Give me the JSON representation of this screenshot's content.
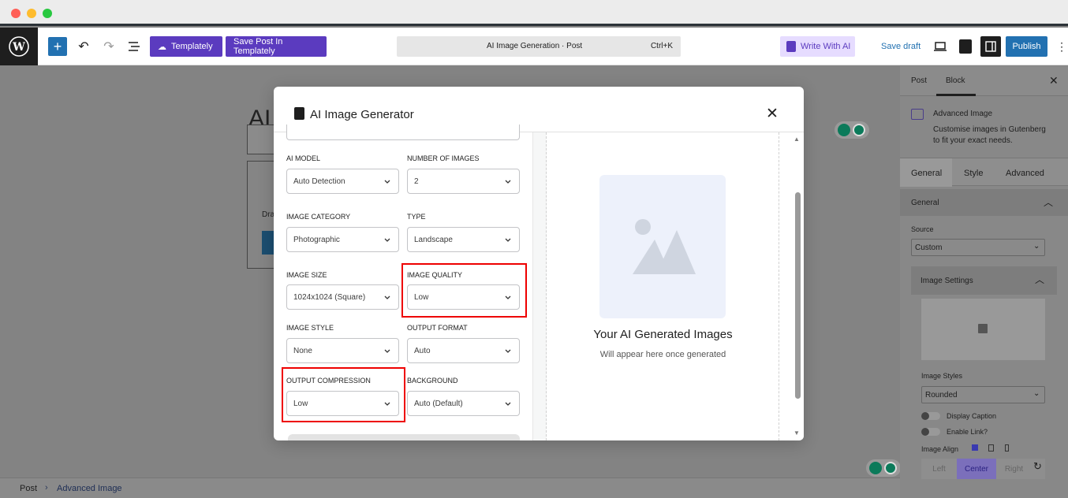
{
  "toolbar": {
    "templately_label": "Templately",
    "save_post_label": "Save Post In Templately",
    "command_title": "AI Image Generation · Post",
    "command_shortcut": "Ctrl+K",
    "write_ai_label": "Write With AI",
    "save_draft_label": "Save draft",
    "publish_label": "Publish"
  },
  "canvas": {
    "heading_fragment": "AI",
    "draft_fragment": "Dra"
  },
  "modal": {
    "title": "AI Image Generator",
    "fields": {
      "ai_model": {
        "label": "AI MODEL",
        "value": "Auto Detection"
      },
      "num_images": {
        "label": "NUMBER OF IMAGES",
        "value": "2"
      },
      "image_category": {
        "label": "IMAGE CATEGORY",
        "value": "Photographic"
      },
      "type": {
        "label": "TYPE",
        "value": "Landscape"
      },
      "image_size": {
        "label": "IMAGE SIZE",
        "value": "1024x1024 (Square)"
      },
      "image_quality": {
        "label": "IMAGE QUALITY",
        "value": "Low"
      },
      "image_style": {
        "label": "IMAGE STYLE",
        "value": "None"
      },
      "output_format": {
        "label": "OUTPUT FORMAT",
        "value": "Auto"
      },
      "output_compression": {
        "label": "OUTPUT COMPRESSION",
        "value": "Low"
      },
      "background": {
        "label": "BACKGROUND",
        "value": "Auto (Default)"
      }
    },
    "preview": {
      "title": "Your AI Generated Images",
      "subtitle": "Will appear here once generated"
    }
  },
  "sidebar": {
    "tab_post": "Post",
    "tab_block": "Block",
    "block_name": "Advanced Image",
    "block_desc_line1": "Customise images in Gutenberg",
    "block_desc_line2": "to fit your exact needs.",
    "subtabs": [
      "General",
      "Style",
      "Advanced"
    ],
    "panel_general": "General",
    "source_label": "Source",
    "source_value": "Custom",
    "panel_image_settings": "Image Settings",
    "image_styles_label": "Image Styles",
    "image_styles_value": "Rounded",
    "display_caption_label": "Display Caption",
    "enable_link_label": "Enable Link?",
    "image_align_label": "Image Align",
    "align_options": [
      "Left",
      "Center",
      "Right"
    ]
  },
  "footer": {
    "crumb_post": "Post",
    "crumb_block": "Advanced Image"
  },
  "colors": {
    "accent_purple": "#5b3bbf",
    "publish_blue": "#2271b1",
    "highlight_red": "#e00000"
  }
}
